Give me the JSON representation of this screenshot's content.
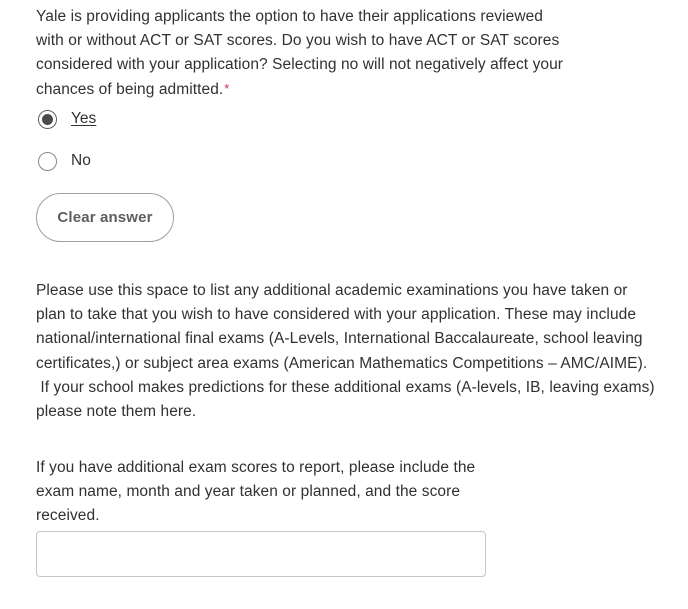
{
  "page": {
    "background_color": "#ffffff",
    "text_color": "#323130"
  },
  "question": {
    "title": "Yale is providing applicants the option to have their applications reviewed\nwith or without ACT or SAT scores. Do you wish to have ACT or SAT scores\nconsidered with your application? Selecting no will not negatively affect your\nchances of being admitted.",
    "required_marker": "*",
    "required_marker_color": "#d92b4b",
    "choices": [
      {
        "label": "Yes",
        "selected": true,
        "hovered": true
      },
      {
        "label": "No",
        "selected": false,
        "hovered": false
      }
    ],
    "clear_answer_label": "Clear answer"
  },
  "description": {
    "text": "Please use this space to list any additional academic examinations you have taken or\nplan to take that you wish to have considered with your application. These may include\nnational/international final exams (A-Levels, International Baccalaureate, school leaving\ncertificates,) or subject area exams (American Mathematics Competitions – AMC/AIME).\n If your school makes predictions for these additional exams (A-levels, IB, leaving exams)\nplease note them here."
  },
  "final": {
    "prompt": "If you have additional exam scores to report, please include the\nexam name, month and year taken or planned, and the score\nreceived.",
    "input_value": "",
    "input_placeholder": ""
  }
}
